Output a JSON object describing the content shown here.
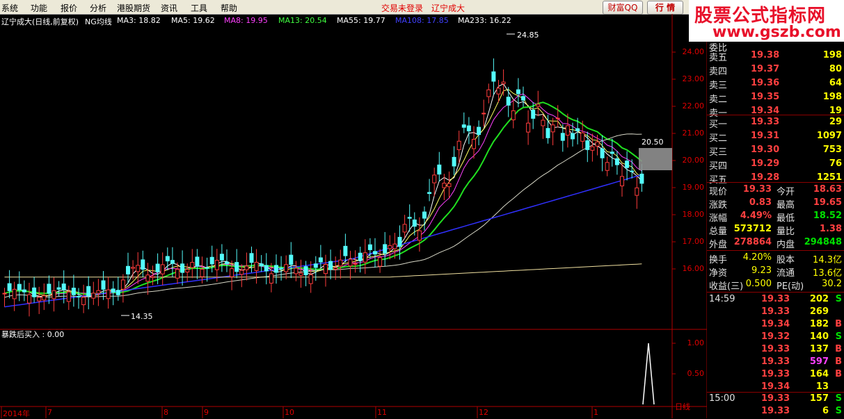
{
  "menu": {
    "items": [
      "系统",
      "功能",
      "报价",
      "分析",
      "港股期货",
      "资讯",
      "工具",
      "帮助"
    ],
    "status_login": "交易未登录",
    "status_stock": "辽宁成大",
    "btn_caifu": "财富QQ",
    "btn_hangqing": "行 情"
  },
  "logo": {
    "title": "股票公式指标网",
    "url": "www.gszb.com"
  },
  "chart": {
    "title": "辽宁成大(日线,前复权)",
    "ma_label": "NG均线",
    "indicators": [
      {
        "label": "MA3: 18.82",
        "color": "#ffffff"
      },
      {
        "label": "MA5: 19.62",
        "color": "#ffffff"
      },
      {
        "label": "MA8: 19.95",
        "color": "#ff40ff"
      },
      {
        "label": "MA13: 20.54",
        "color": "#40ff40"
      },
      {
        "label": "MA55: 19.77",
        "color": "#ffffff"
      },
      {
        "label": "MA108: 17.85",
        "color": "#4040ff"
      },
      {
        "label": "MA233: 16.22",
        "color": "#ffffff"
      }
    ],
    "high_label": "24.85",
    "low_label": "14.35",
    "mid_label": "20.50",
    "y_ticks": [
      "24.00",
      "23.00",
      "22.00",
      "21.00",
      "20.00",
      "19.00",
      "18.00",
      "17.00",
      "16.00"
    ],
    "sub_title": "暴跌后买入 : 0.00",
    "sub_ticks": [
      "1.00",
      "0.50"
    ],
    "date_ticks": [
      "2014年",
      "7",
      "8",
      "9",
      "10",
      "11",
      "12",
      "1"
    ],
    "period": "日线"
  },
  "quote": {
    "header_partial": "委比",
    "asks": [
      {
        "label": "卖五",
        "price": "19.38",
        "vol": "198"
      },
      {
        "label": "卖四",
        "price": "19.37",
        "vol": "80"
      },
      {
        "label": "卖三",
        "price": "19.36",
        "vol": "64"
      },
      {
        "label": "卖二",
        "price": "19.35",
        "vol": "198"
      },
      {
        "label": "卖一",
        "price": "19.34",
        "vol": "19"
      }
    ],
    "bids": [
      {
        "label": "买一",
        "price": "19.33",
        "vol": "29"
      },
      {
        "label": "买二",
        "price": "19.31",
        "vol": "1097"
      },
      {
        "label": "买三",
        "price": "19.30",
        "vol": "753"
      },
      {
        "label": "买四",
        "price": "19.29",
        "vol": "76"
      },
      {
        "label": "买五",
        "price": "19.28",
        "vol": "1251"
      }
    ],
    "stats": [
      {
        "l1": "现价",
        "v1": "19.33",
        "c1": "#ff4040",
        "l2": "今开",
        "v2": "18.63",
        "c2": "#ff4040"
      },
      {
        "l1": "涨跌",
        "v1": "0.83",
        "c1": "#ff4040",
        "l2": "最高",
        "v2": "19.65",
        "c2": "#ff4040"
      },
      {
        "l1": "涨幅",
        "v1": "4.49%",
        "c1": "#ff4040",
        "l2": "最低",
        "v2": "18.52",
        "c2": "#00e000"
      },
      {
        "l1": "总量",
        "v1": "573712",
        "c1": "#ffff00",
        "l2": "量比",
        "v2": "1.38",
        "c2": "#ff4040"
      },
      {
        "l1": "外盘",
        "v1": "278864",
        "c1": "#ff4040",
        "l2": "内盘",
        "v2": "294848",
        "c2": "#00e000"
      }
    ],
    "stats2": [
      {
        "l1": "换手",
        "v1": "4.20%",
        "l2": "股本",
        "v2": "14.3亿"
      },
      {
        "l1": "净资",
        "v1": "9.23",
        "l2": "流通",
        "v2": "13.6亿"
      },
      {
        "l1": "收益(三)",
        "v1": "0.500",
        "l2": "PE(动)",
        "v2": "30.2"
      }
    ],
    "ticks1": [
      {
        "time": "14:59",
        "price": "19.33",
        "vol": "202",
        "bs": "S"
      },
      {
        "time": "",
        "price": "19.33",
        "vol": "269",
        "bs": ""
      },
      {
        "time": "",
        "price": "19.34",
        "vol": "182",
        "bs": "B"
      },
      {
        "time": "",
        "price": "19.32",
        "vol": "140",
        "bs": "S"
      },
      {
        "time": "",
        "price": "19.33",
        "vol": "137",
        "bs": "B"
      },
      {
        "time": "",
        "price": "19.33",
        "vol": "597",
        "bs": "B"
      },
      {
        "time": "",
        "price": "19.33",
        "vol": "164",
        "bs": "B"
      },
      {
        "time": "",
        "price": "19.34",
        "vol": "13",
        "bs": ""
      }
    ],
    "ticks2": [
      {
        "time": "15:00",
        "price": "19.33",
        "vol": "157",
        "bs": "S"
      },
      {
        "time": "",
        "price": "19.33",
        "vol": "6",
        "bs": "S"
      }
    ]
  }
}
